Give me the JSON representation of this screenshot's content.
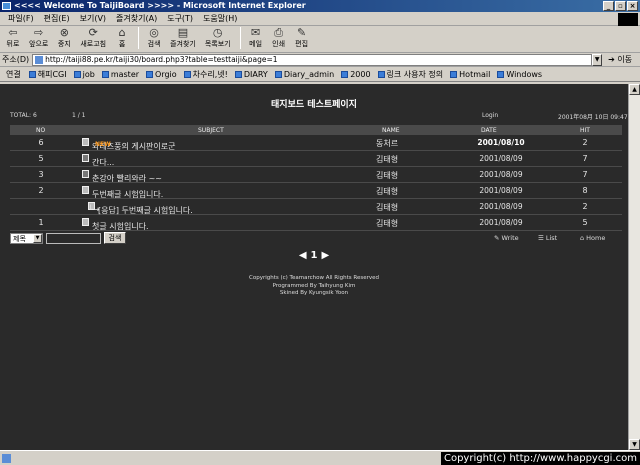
{
  "window": {
    "title": "<<<< Welcome To TaijiBoard >>>> - Microsoft Internet Explorer",
    "buttons": [
      "_",
      "▫",
      "×"
    ]
  },
  "menu": {
    "items": [
      "파일(F)",
      "편집(E)",
      "보기(V)",
      "즐겨찾기(A)",
      "도구(T)",
      "도움말(H)"
    ]
  },
  "toolbar": {
    "back": "뒤로",
    "forward": "앞으로",
    "stop": "중지",
    "refresh": "새로고침",
    "home": "홈",
    "search": "검색",
    "favorites": "즐겨찾기",
    "history": "목록보기",
    "mail": "메일",
    "print": "인쇄",
    "edit": "편집"
  },
  "address": {
    "label": "주소(D)",
    "url": "http://taiji88.pe.kr/taiji30/board.php3?table=testtaiji&page=1",
    "go": "이동"
  },
  "links": {
    "title": "연결",
    "items": [
      "해피CGI",
      "job",
      "master",
      "Orgio",
      "차수리,넷!",
      "DIARY",
      "Diary_admin",
      "2000",
      "링크 사용자 정의",
      "Hotmail",
      "Windows"
    ]
  },
  "board": {
    "title": "태지보드 테스트페이지",
    "total": "TOTAL: 6",
    "page_info": "1 / 1",
    "login": "Login",
    "now": "2001年08月 10日 09:47",
    "headers": {
      "no": "NO",
      "subject": "SUBJECT",
      "name": "NAME",
      "date": "DATE",
      "hit": "HIT"
    },
    "rows": [
      {
        "no": "6",
        "subject": "와레즈풍의 게시판이로군",
        "badge": "NEW",
        "name": "동처르",
        "date": "2001/08/10",
        "hit": "2"
      },
      {
        "no": "5",
        "subject": "간다...",
        "badge": "",
        "name": "김태형",
        "date": "2001/08/09",
        "hit": "7"
      },
      {
        "no": "3",
        "subject": "춘강아 빨리와라 ~~",
        "badge": "",
        "name": "김태형",
        "date": "2001/08/09",
        "hit": "7"
      },
      {
        "no": "2",
        "subject": "두번째글 시험입니다.",
        "badge": "",
        "name": "김태형",
        "date": "2001/08/09",
        "hit": "8"
      },
      {
        "no": "",
        "subject": "[응답] 두번째글 시험입니다.",
        "badge": "",
        "name": "김태형",
        "date": "2001/08/09",
        "hit": "2"
      },
      {
        "no": "1",
        "subject": "첫글 시험입니다.",
        "badge": "",
        "name": "김태형",
        "date": "2001/08/09",
        "hit": "5"
      }
    ],
    "search_field": "제목",
    "search_button": "검색",
    "write": "Write",
    "list": "List",
    "home": "Home",
    "pager": {
      "prev": "◀",
      "current": "1",
      "next": "▶"
    },
    "credits": [
      "Copyrights (c) Teamarchow All Rights Reserved",
      "Programmed By Taihyung Kim",
      "Skined By Kyungsik Yoon"
    ]
  },
  "status": {
    "watermark": "Copyright(c) http://www.happycgi.com"
  }
}
